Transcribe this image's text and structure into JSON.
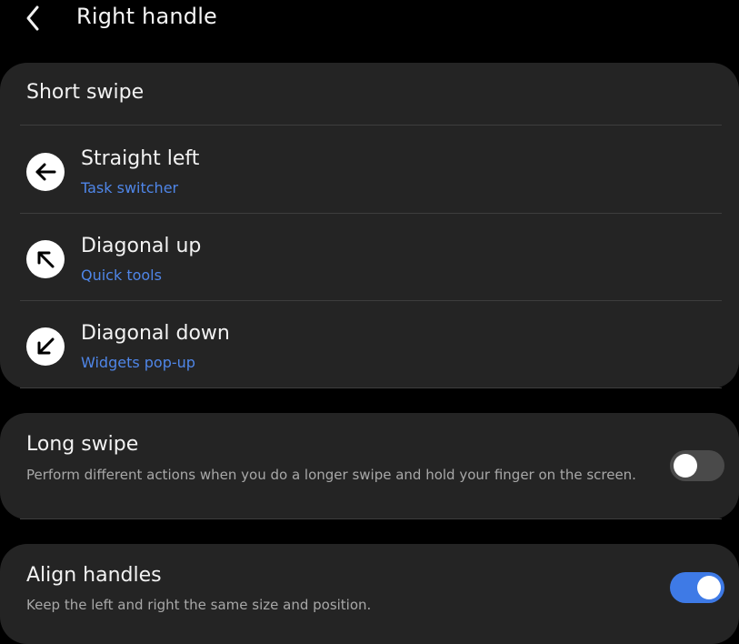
{
  "header": {
    "back_icon": "chevron-left-icon",
    "title": "Right handle"
  },
  "short_swipe": {
    "title": "Short swipe",
    "items": [
      {
        "label": "Straight left",
        "value": "Task switcher",
        "icon": "arrow-left-icon"
      },
      {
        "label": "Diagonal up",
        "value": "Quick tools",
        "icon": "arrow-up-left-icon"
      },
      {
        "label": "Diagonal down",
        "value": "Widgets pop-up",
        "icon": "arrow-down-left-icon"
      }
    ]
  },
  "long_swipe": {
    "title": "Long swipe",
    "description": "Perform different actions when you do a longer swipe and hold your finger on the screen.",
    "enabled": false
  },
  "align_handles": {
    "title": "Align handles",
    "description": "Keep the left and right the same size and position.",
    "enabled": true
  },
  "colors": {
    "background": "#000000",
    "card": "#242424",
    "accent": "#3e7ae6",
    "link": "#4f86e8",
    "secondary_text": "#a8a8a8"
  }
}
